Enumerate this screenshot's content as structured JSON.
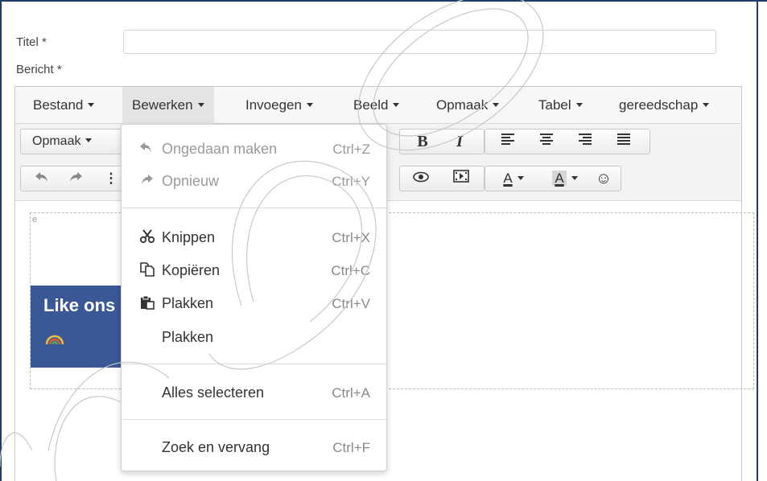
{
  "form": {
    "title_label": "Titel *",
    "message_label": "Bericht *",
    "title_value": ""
  },
  "menubar": {
    "items": [
      "Bestand",
      "Bewerken",
      "Invoegen",
      "Beeld",
      "Opmaak",
      "Tabel",
      "gereedschap"
    ],
    "active": "Bewerken"
  },
  "toolbar": {
    "format_dropdown": "Opmaak",
    "bold": "B",
    "italic": "I",
    "text_color": "A",
    "bg_color": "A",
    "icons_row1": [
      "bold-icon",
      "italic-icon",
      "align-left-icon",
      "align-center-icon",
      "align-right-icon",
      "align-justify-icon"
    ],
    "icons_row2": [
      "undo-icon",
      "redo-icon",
      "preview-icon",
      "media-icon",
      "text-color-icon",
      "background-color-icon",
      "emoticon-icon"
    ]
  },
  "content": {
    "facebook_text": "Like ons",
    "placeholder_char": "e"
  },
  "edit_menu": {
    "items": [
      {
        "label": "Ongedaan maken",
        "shortcut": "Ctrl+Z",
        "icon": "undo-icon",
        "disabled": true
      },
      {
        "label": "Opnieuw",
        "shortcut": "Ctrl+Y",
        "icon": "redo-icon",
        "disabled": true
      },
      {
        "label": "Knippen",
        "shortcut": "Ctrl+X",
        "icon": "scissors-icon",
        "disabled": false
      },
      {
        "label": "Kopiëren",
        "shortcut": "Ctrl+C",
        "icon": "copy-icon",
        "disabled": false
      },
      {
        "label": "Plakken",
        "shortcut": "Ctrl+V",
        "icon": "paste-icon",
        "disabled": false
      },
      {
        "label": "Plakken",
        "shortcut": "",
        "icon": "",
        "disabled": false
      },
      {
        "label": "Alles selecteren",
        "shortcut": "Ctrl+A",
        "icon": "",
        "disabled": false
      },
      {
        "label": "Zoek en vervang",
        "shortcut": "Ctrl+F",
        "icon": "",
        "disabled": false
      }
    ]
  },
  "colors": {
    "frame": "#1d3c66",
    "facebook": "#3a5895",
    "menubar_bg": "#f7f7f7"
  }
}
